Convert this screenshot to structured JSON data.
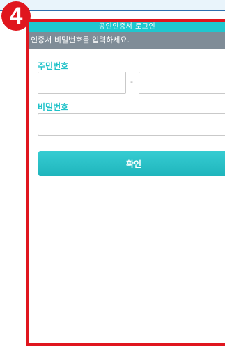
{
  "window": {
    "title": "공인인증서 로그인",
    "subtitle": "인증서 비밀번호를 입력하세요."
  },
  "step_marker": "4",
  "form": {
    "rrn_label": "주민번호",
    "rrn_separator": "-",
    "rrn_first_value": "",
    "rrn_second_value": "",
    "password_label": "비밀번호",
    "password_value": "",
    "confirm_label": "확인"
  },
  "colors": {
    "accent": "#1fc7cf",
    "label": "#1fc2c9",
    "subtitle_bg": "#7f8c97",
    "highlight_border": "#e0161e"
  }
}
